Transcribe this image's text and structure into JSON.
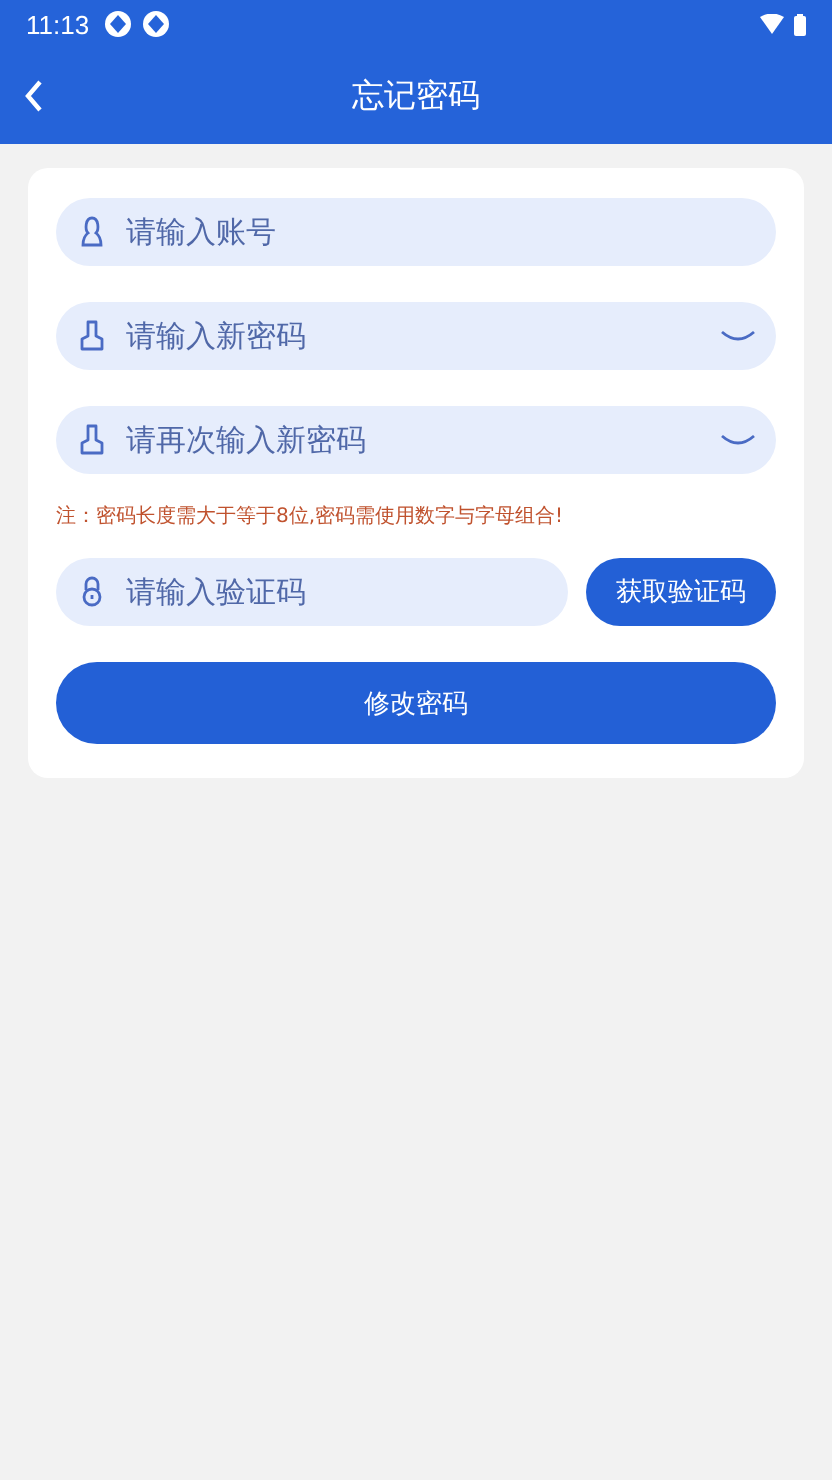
{
  "status_bar": {
    "time": "11:13"
  },
  "app_bar": {
    "title": "忘记密码"
  },
  "fields": [
    {
      "kind": "account",
      "placeholder": "请输入账号",
      "eye": false
    },
    {
      "kind": "password",
      "placeholder": "请输入新密码",
      "eye": true
    },
    {
      "kind": "password",
      "placeholder": "请再次输入新密码",
      "eye": true
    }
  ],
  "note": "注：密码长度需大于等于8位,密码需使用数字与字母组合!",
  "code_field": {
    "kind": "code",
    "placeholder": "请输入验证码"
  },
  "code_button": "获取验证码",
  "submit_button": "修改密码"
}
